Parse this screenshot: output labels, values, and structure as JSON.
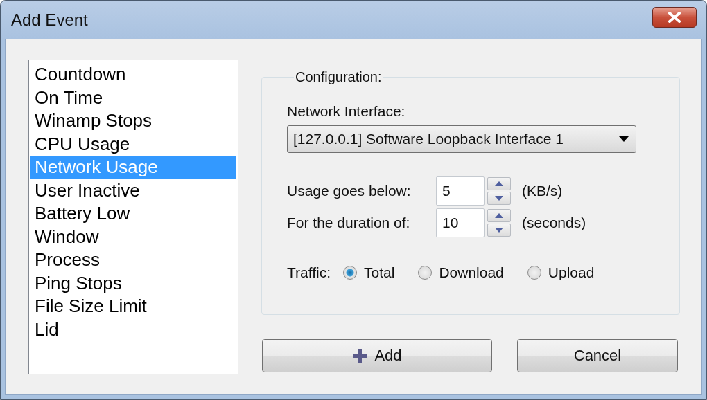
{
  "window": {
    "title": "Add Event"
  },
  "events": [
    {
      "label": "Countdown",
      "selected": false
    },
    {
      "label": "On Time",
      "selected": false
    },
    {
      "label": "Winamp Stops",
      "selected": false
    },
    {
      "label": "CPU Usage",
      "selected": false
    },
    {
      "label": "Network Usage",
      "selected": true
    },
    {
      "label": "User Inactive",
      "selected": false
    },
    {
      "label": "Battery Low",
      "selected": false
    },
    {
      "label": "Window",
      "selected": false
    },
    {
      "label": "Process",
      "selected": false
    },
    {
      "label": "Ping Stops",
      "selected": false
    },
    {
      "label": "File Size Limit",
      "selected": false
    },
    {
      "label": "Lid",
      "selected": false
    }
  ],
  "configuration": {
    "legend": "Configuration:",
    "network_interface": {
      "label": "Network Interface:",
      "value": "[127.0.0.1] Software Loopback Interface 1"
    },
    "spinners": [
      {
        "label": "Usage goes below:",
        "value": "5",
        "unit": "(KB/s)"
      },
      {
        "label": "For the duration of:",
        "value": "10",
        "unit": "(seconds)"
      }
    ],
    "traffic": {
      "label": "Traffic:",
      "options": [
        {
          "label": "Total",
          "selected": true
        },
        {
          "label": "Download",
          "selected": false
        },
        {
          "label": "Upload",
          "selected": false
        }
      ]
    }
  },
  "buttons": [
    {
      "label": "Add",
      "kind": "add"
    },
    {
      "label": "Cancel",
      "kind": "plain"
    }
  ]
}
